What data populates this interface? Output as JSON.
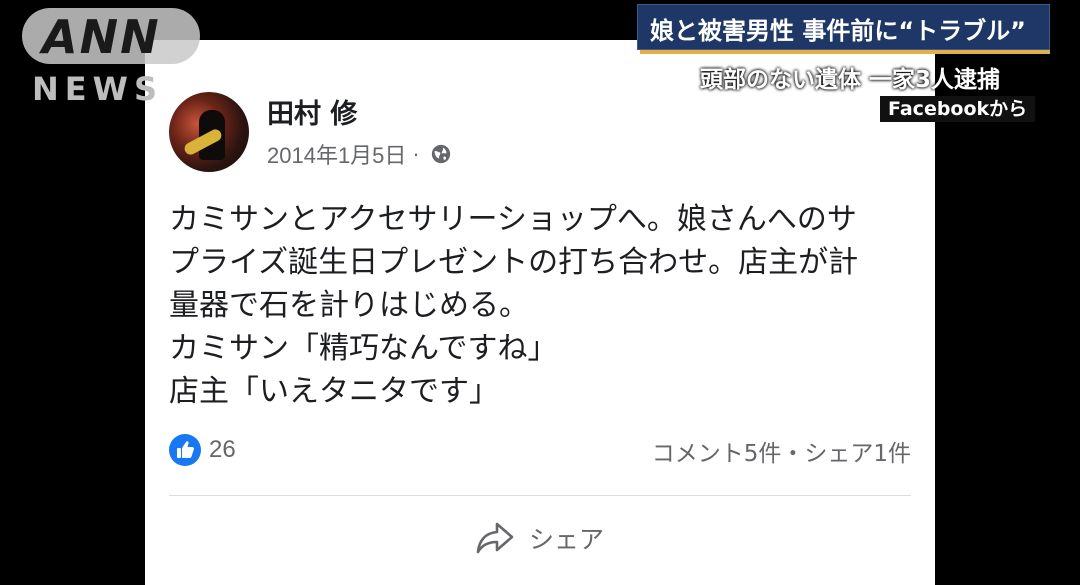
{
  "watermark": {
    "logo_text": "ANN",
    "sub_text": "NEWS"
  },
  "caption": {
    "headline": "娘と被害男性 事件前に“トラブル”",
    "subheadline": "頭部のない遺体 一家3人逮捕",
    "source": "Facebookから"
  },
  "post": {
    "author": "田村 修",
    "date": "2014年1月5日",
    "separator": "·",
    "privacy_icon": "globe-icon",
    "lines": [
      "カミサンとアクセサリーショップへ。娘さんへのサ",
      "プライズ誕生日プレゼントの打ち合わせ。店主が計",
      "量器で石を計りはじめる。",
      "カミサン「精巧なんですね」",
      "店主「いえタニタです」"
    ],
    "reaction_icon": "like-icon",
    "reaction_count": "26",
    "stats": "コメント5件・シェア1件",
    "share_label": "シェア",
    "share_icon": "share-icon"
  },
  "colors": {
    "background": "#000000",
    "card": "#ffffff",
    "facebook_blue": "#1877f2",
    "caption_navy": "#1e3766",
    "caption_gold": "#e0b14a",
    "muted_text": "#65676b"
  }
}
